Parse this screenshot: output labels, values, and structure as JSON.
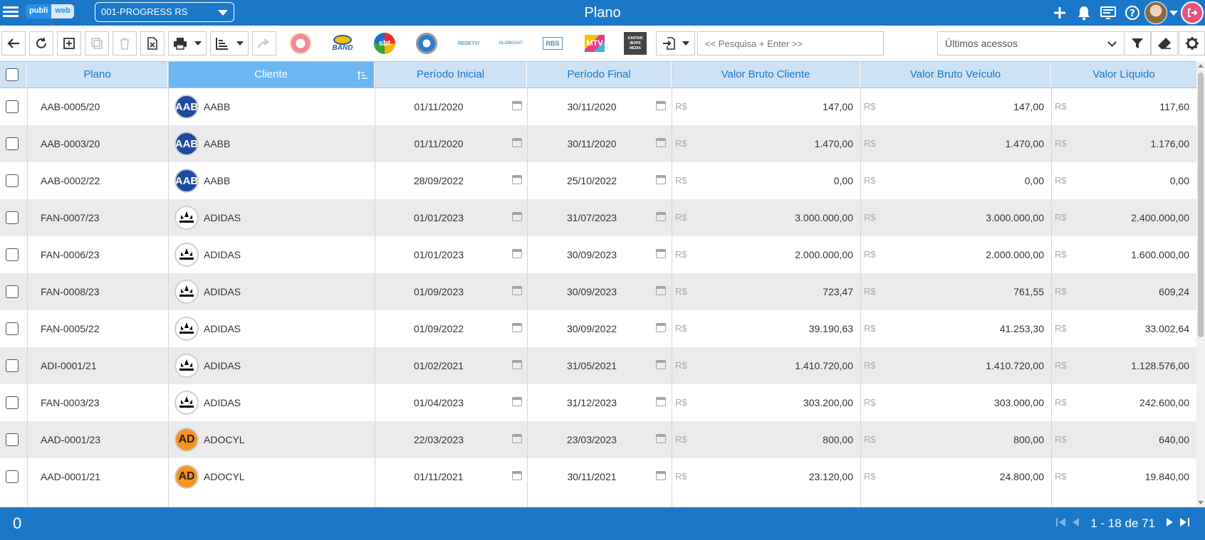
{
  "topbar": {
    "company": "001-PROGRESS RS",
    "title": "Plano",
    "logo_a": "publi",
    "logo_b": "web"
  },
  "toolbar": {
    "search_placeholder": "<< Pesquisa + Enter >>",
    "recent_label": "Últimos acessos",
    "media": [
      "Globo",
      "BAND",
      "sbt",
      "Record",
      "RedeTV",
      "GloboSat",
      "RBS",
      "MTV",
      "KANTAR IBOPE MEDIA"
    ]
  },
  "grid": {
    "headers": {
      "plano": "Plano",
      "cliente": "Cliente",
      "periodo_inicial": "Período Inicial",
      "periodo_final": "Período Final",
      "valor_bruto_cliente": "Valor Bruto Cliente",
      "valor_bruto_veiculo": "Valor Bruto Veículo",
      "valor_liquido": "Valor Líquido"
    },
    "currency": "R$",
    "rows": [
      {
        "plano": "AAB-0005/20",
        "cliente": "AABB",
        "logo": "AAB",
        "ini": "01/11/2020",
        "fim": "30/11/2020",
        "vbc": "147,00",
        "vbv": "147,00",
        "vl": "117,60"
      },
      {
        "plano": "AAB-0003/20",
        "cliente": "AABB",
        "logo": "AAB",
        "ini": "01/11/2020",
        "fim": "30/11/2020",
        "vbc": "1.470,00",
        "vbv": "1.470,00",
        "vl": "1.176,00"
      },
      {
        "plano": "AAB-0002/22",
        "cliente": "AABB",
        "logo": "AAB",
        "ini": "28/09/2022",
        "fim": "25/10/2022",
        "vbc": "0,00",
        "vbv": "0,00",
        "vl": "0,00"
      },
      {
        "plano": "FAN-0007/23",
        "cliente": "ADIDAS",
        "logo": "adidas",
        "ini": "01/01/2023",
        "fim": "31/07/2023",
        "vbc": "3.000.000,00",
        "vbv": "3.000.000,00",
        "vl": "2.400.000,00"
      },
      {
        "plano": "FAN-0006/23",
        "cliente": "ADIDAS",
        "logo": "adidas",
        "ini": "01/01/2023",
        "fim": "30/09/2023",
        "vbc": "2.000.000,00",
        "vbv": "2.000.000,00",
        "vl": "1.600.000,00"
      },
      {
        "plano": "FAN-0008/23",
        "cliente": "ADIDAS",
        "logo": "adidas",
        "ini": "01/09/2023",
        "fim": "30/09/2023",
        "vbc": "723,47",
        "vbv": "761,55",
        "vl": "609,24"
      },
      {
        "plano": "FAN-0005/22",
        "cliente": "ADIDAS",
        "logo": "adidas",
        "ini": "01/09/2022",
        "fim": "30/09/2022",
        "vbc": "39.190,63",
        "vbv": "41.253,30",
        "vl": "33.002,64"
      },
      {
        "plano": "ADI-0001/21",
        "cliente": "ADIDAS",
        "logo": "adidas",
        "ini": "01/02/2021",
        "fim": "31/05/2021",
        "vbc": "1.410.720,00",
        "vbv": "1.410.720,00",
        "vl": "1.128.576,00"
      },
      {
        "plano": "FAN-0003/23",
        "cliente": "ADIDAS",
        "logo": "adidas",
        "ini": "01/04/2023",
        "fim": "31/12/2023",
        "vbc": "303.200,00",
        "vbv": "303.000,00",
        "vl": "242.600,00"
      },
      {
        "plano": "AAD-0001/23",
        "cliente": "ADOCYL",
        "logo": "AD",
        "ini": "22/03/2023",
        "fim": "23/03/2023",
        "vbc": "800,00",
        "vbv": "800,00",
        "vl": "640,00"
      },
      {
        "plano": "AAD-0001/21",
        "cliente": "ADOCYL",
        "logo": "AD",
        "ini": "01/11/2021",
        "fim": "30/11/2021",
        "vbc": "23.120,00",
        "vbv": "24.800,00",
        "vl": "19.840,00"
      }
    ]
  },
  "footer": {
    "selected_count": "0",
    "page_info": "1 - 18 de 71"
  }
}
